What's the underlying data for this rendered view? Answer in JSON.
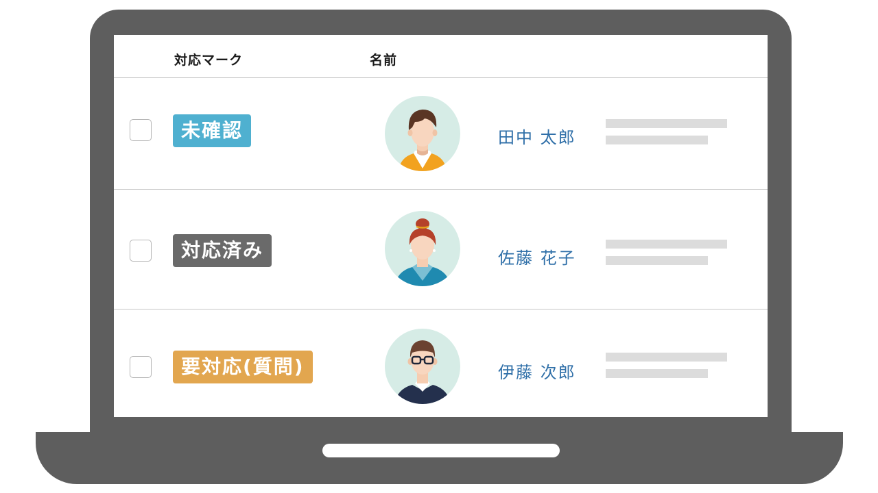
{
  "table": {
    "headers": {
      "mark": "対応マーク",
      "name": "名前"
    },
    "rows": [
      {
        "tag": "未確認",
        "tag_color": "#4fb0d0",
        "name": "田中 太郎",
        "avatar": "man-brown-hair-orange-shirt"
      },
      {
        "tag": "対応済み",
        "tag_color": "#6a6a6a",
        "name": "佐藤 花子",
        "avatar": "woman-red-bun-teal-top"
      },
      {
        "tag": "要対応(質問)",
        "tag_color": "#e2a64f",
        "name": "伊藤 次郎",
        "avatar": "man-glasses-navy-sweater"
      }
    ]
  },
  "colors": {
    "frame": "#5e5e5e",
    "name_text": "#2f6fa8",
    "placeholder": "#dcdcdc"
  }
}
